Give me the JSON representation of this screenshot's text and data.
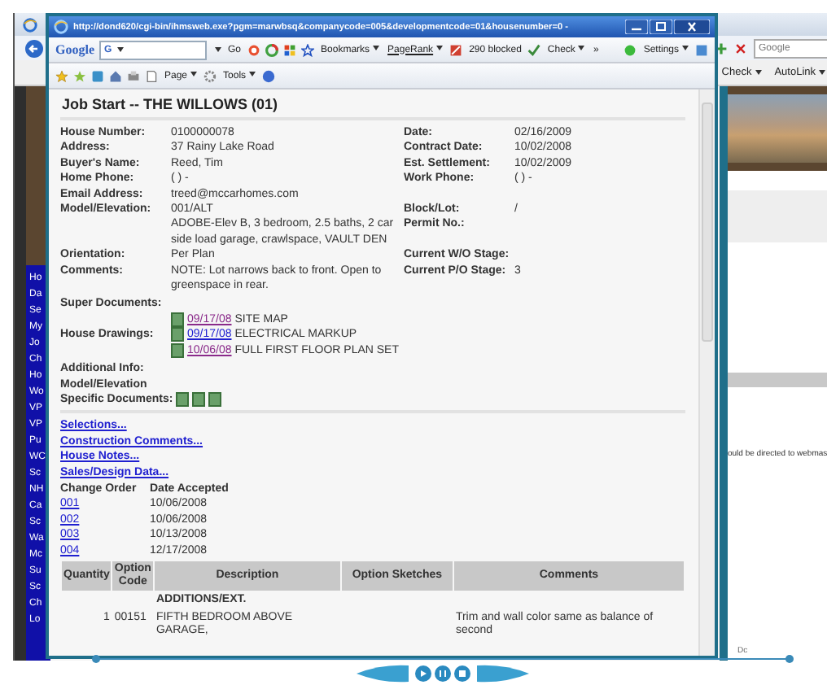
{
  "background_window": {
    "toolbar": {
      "search": {
        "placeholder": "Google"
      },
      "buttons": [
        {
          "label": "Check"
        },
        {
          "label": "AutoLink"
        }
      ]
    },
    "sidebar": {
      "items": [
        "Ho",
        "Da",
        "Se",
        "My",
        "Jo",
        "Ch",
        "Ho",
        "Wo",
        "VP",
        "VP",
        "Pu",
        "WC",
        "Sc",
        "NH",
        "Ca",
        "Sc",
        "Wa",
        "Mc",
        "Su",
        "Sc",
        "Ch",
        "Lo"
      ]
    },
    "notice": "ould be directed to webmas",
    "footer_text": "Dc"
  },
  "popup": {
    "title": "http://dond620/cgi-bin/ihmsweb.exe?pgm=marwbsq&companycode=005&developmentcode=01&housenumber=0 -",
    "google_toolbar": {
      "logo": "Google",
      "search_button": "G",
      "go": "Go",
      "bookmarks": "Bookmarks",
      "pagerank": "PageRank",
      "blocked": "290 blocked",
      "check": "Check",
      "more": "»",
      "settings": "Settings"
    },
    "command_bar": {
      "page": "Page",
      "tools": "Tools"
    },
    "heading": "Job Start -- THE WILLOWS (01)",
    "fields": [
      {
        "left": {
          "label": "House Number:",
          "value": "0100000078"
        },
        "right": {
          "label": "Date:",
          "value": "02/16/2009"
        }
      },
      {
        "left": {
          "label": "Address:",
          "value": "37 Rainy Lake Road"
        },
        "right": {
          "label": "Contract Date:",
          "value": "10/02/2008"
        }
      },
      {
        "left": {
          "label": "Buyer's Name:",
          "value": "Reed, Tim"
        },
        "right": {
          "label": "Est. Settlement:",
          "value": "10/02/2009"
        }
      },
      {
        "left": {
          "label": "Home Phone:",
          "value": "( ) -"
        },
        "right": {
          "label": "Work Phone:",
          "value": "( ) -"
        }
      },
      {
        "left": {
          "label": "Email Address:",
          "value": "treed@mccarhomes.com"
        }
      },
      {
        "left": {
          "label": "Model/Elevation:",
          "value": "001/ALT"
        },
        "right": {
          "label": "Block/Lot:",
          "value": "/"
        }
      },
      {
        "left": {
          "value": "ADOBE-Elev B, 3 bedroom, 2.5 baths, 2 car side load garage, crawlspace, VAULT DEN"
        },
        "right": {
          "label": "Permit No.:"
        }
      },
      {
        "left": {
          "label": "Orientation:",
          "value": "Per Plan"
        },
        "right": {
          "label": "Current W/O Stage:"
        }
      },
      {
        "left": {
          "label": "Comments:",
          "value": "NOTE: Lot narrows back to front. Open to greenspace in rear."
        },
        "right": {
          "label": "Current P/O Stage:",
          "value": "3"
        }
      }
    ],
    "super_documents": {
      "label": "Super Documents:"
    },
    "house_drawings": {
      "label": "House Drawings:",
      "documents": [
        {
          "date": "09/17/08",
          "title": "SITE MAP",
          "visited": true
        },
        {
          "date": "09/17/08",
          "title": "ELECTRICAL MARKUP",
          "visited": false
        },
        {
          "date": "10/06/08",
          "title": "FULL FIRST FLOOR PLAN SET",
          "visited": true
        }
      ]
    },
    "additional_info": {
      "label": "Additional Info:"
    },
    "specific_documents": {
      "label_lines": [
        "Model/Elevation",
        "Specific Documents:"
      ]
    },
    "links": [
      "Selections...",
      "Construction Comments...",
      "House Notes...",
      "Sales/Design Data..."
    ],
    "change_orders": {
      "columns": [
        "Change Order",
        "Date Accepted"
      ],
      "rows": [
        {
          "number": "001",
          "date": "10/06/2008"
        },
        {
          "number": "002",
          "date": "10/06/2008"
        },
        {
          "number": "003",
          "date": "10/13/2008"
        },
        {
          "number": "004",
          "date": "12/17/2008"
        }
      ]
    },
    "options_table": {
      "columns": [
        "Quantity",
        "Option Code",
        "Description",
        "Option Sketches",
        "Comments"
      ],
      "rows": [
        {
          "kind": "group",
          "description": "ADDITIONS/EXT."
        },
        {
          "kind": "item",
          "quantity": "1",
          "code": "00151",
          "description": "FIFTH BEDROOM ABOVE GARAGE,",
          "comments": "Trim and wall color same as balance of second"
        }
      ]
    }
  }
}
